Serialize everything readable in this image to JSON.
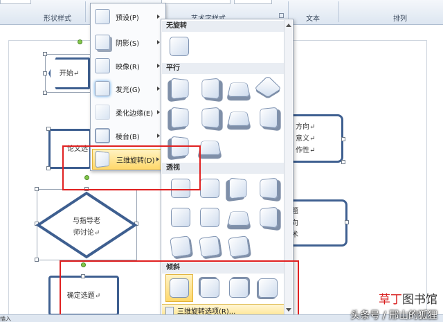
{
  "ribbon": {
    "groups": {
      "shape_styles": "形状样式",
      "wordart_styles": "艺术字样式",
      "text": "文本",
      "arrange": "排列"
    }
  },
  "document": {
    "shapes": {
      "start": "开始",
      "thesis": "论文选",
      "discuss_line1": "与指导老",
      "discuss_line2": "师讨论",
      "confirm": "确定选题",
      "right_top_line1": "方向",
      "right_top_line2": "意义",
      "right_top_line3": "作性",
      "right_mid_line1": "题",
      "right_mid_line2": "向",
      "right_mid_line3": "术"
    },
    "paragraph_mark": "↵"
  },
  "menu": {
    "items": [
      {
        "label": "预设(P)",
        "icon": "preset-icon"
      },
      {
        "label": "阴影(S)",
        "icon": "shadow-icon"
      },
      {
        "label": "映像(R)",
        "icon": "reflection-icon"
      },
      {
        "label": "发光(G)",
        "icon": "glow-icon"
      },
      {
        "label": "柔化边缘(E)",
        "icon": "soft-edges-icon"
      },
      {
        "label": "棱台(B)",
        "icon": "bevel-icon"
      },
      {
        "label": "三维旋转(D)",
        "icon": "3d-rotation-icon",
        "active": true
      }
    ]
  },
  "gallery": {
    "sections": {
      "no_rotation": "无旋转",
      "parallel": "平行",
      "perspective": "透视",
      "oblique": "倾斜"
    },
    "footer_label": "三维旋转选项(R)..."
  },
  "watermark": {
    "brand_red": "草丁",
    "brand_rest": "图书馆",
    "byline": "头条号 / 邢山的狐狸"
  },
  "status_bar": {
    "left_text": "插入"
  },
  "colors": {
    "highlight": "#e02020",
    "shape_border": "#3e5f90",
    "menu_active": "#ffd86b"
  }
}
